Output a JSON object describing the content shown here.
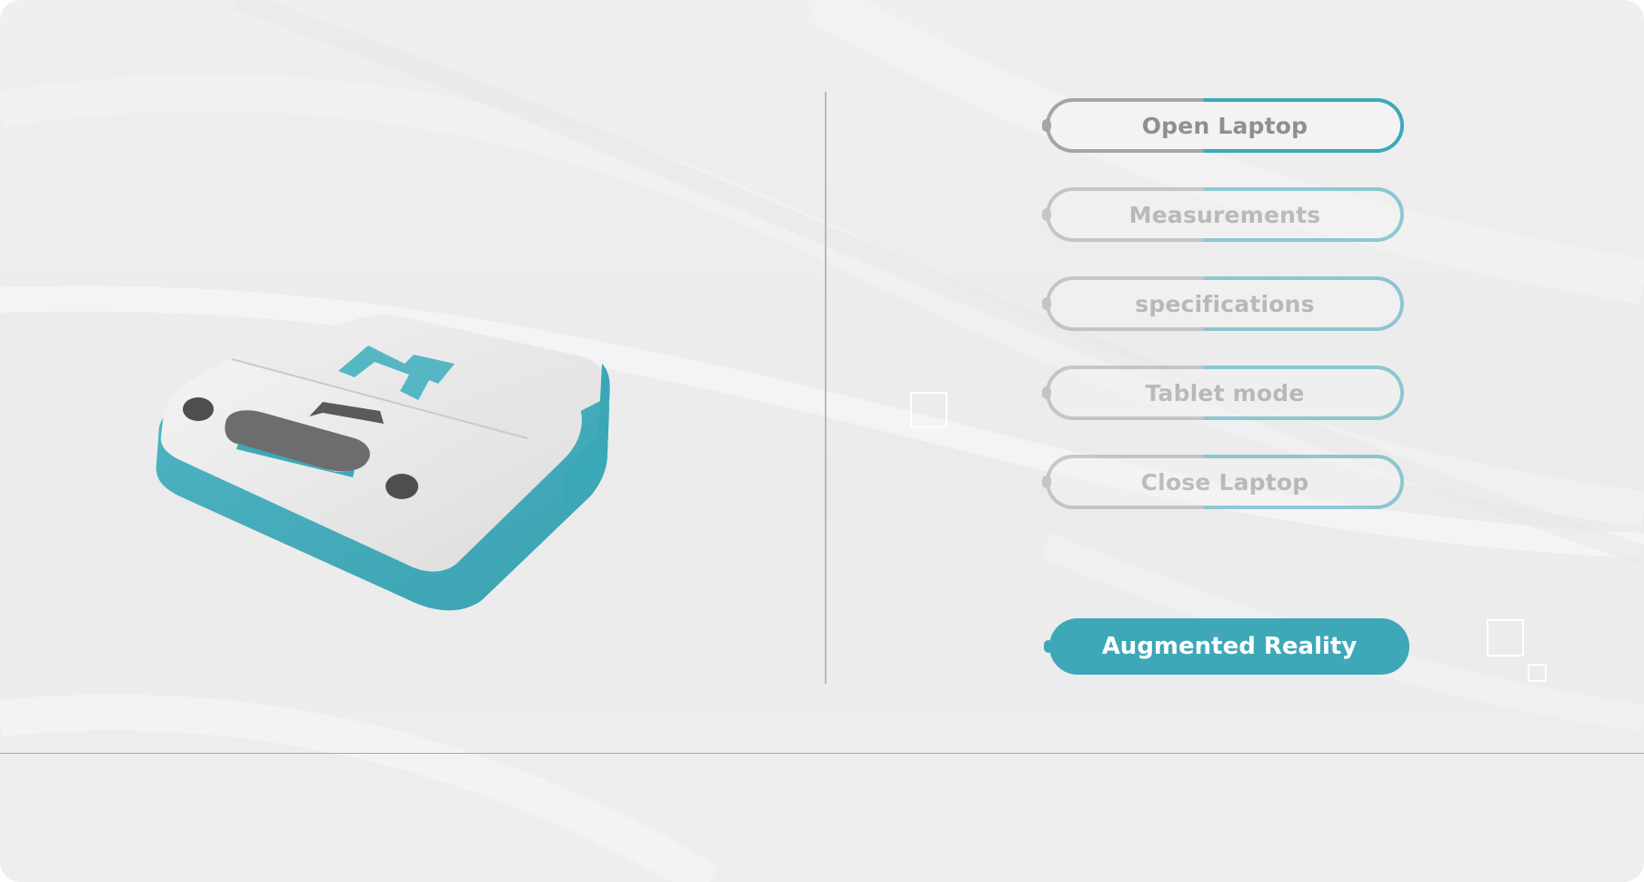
{
  "menu": {
    "items": [
      {
        "label": "Open Laptop",
        "state": "enabled"
      },
      {
        "label": "Measurements",
        "state": "dimmed"
      },
      {
        "label": "specifications",
        "state": "dimmed"
      },
      {
        "label": "Tablet mode",
        "state": "dimmed"
      },
      {
        "label": "Close Laptop",
        "state": "dimmed"
      }
    ],
    "primary_action": {
      "label": "Augmented Reality"
    }
  },
  "model": {
    "name": "laptop-3d-model",
    "logo_glyph": "M"
  },
  "colors": {
    "accent": "#3ea8b8",
    "outline_gray": "#a5a5a7",
    "text_gray": "#8f8f91",
    "background": "#ededee",
    "model_body": "#e6e6e6"
  }
}
